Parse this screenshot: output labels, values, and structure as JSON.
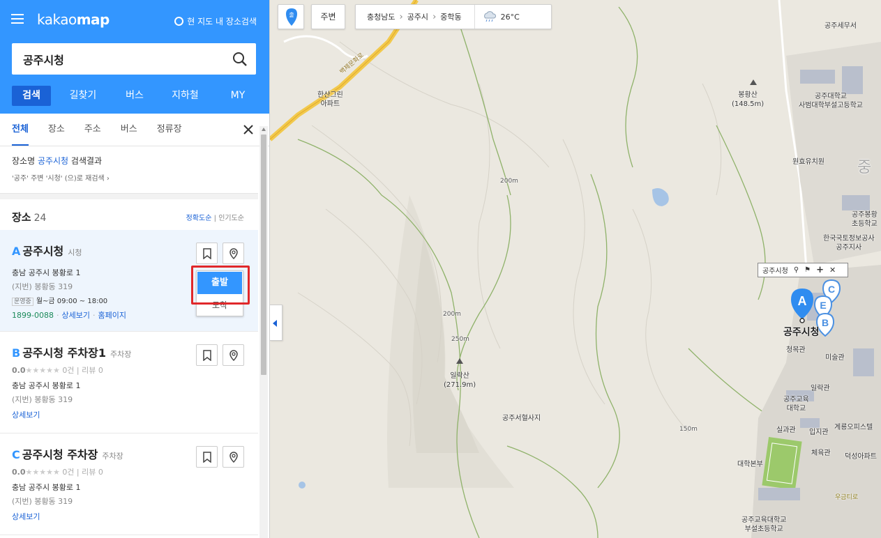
{
  "app": {
    "logo_light": "kakao",
    "logo_bold": "map",
    "area_search_label": "현 지도 내 장소검색"
  },
  "search": {
    "value": "공주시청"
  },
  "main_tabs": [
    "검색",
    "길찾기",
    "버스",
    "지하철",
    "MY"
  ],
  "sub_tabs": [
    "전체",
    "장소",
    "주소",
    "버스",
    "정류장"
  ],
  "result": {
    "prefix": "장소명 ",
    "keyword": "공주시청",
    "suffix": " 검색결과",
    "research": "'공주' 주변 '시청' (으)로 재검색"
  },
  "places": {
    "label": "장소",
    "count": "24",
    "sort_accuracy": "정확도순",
    "sort_sep": "|",
    "sort_popular": "인기도순"
  },
  "cards": [
    {
      "marker": "A",
      "name": "공주시청",
      "category": "시청",
      "address": "충남 공주시 봉황로 1",
      "jibun": "(지번) 봉황동 319",
      "hours_badge": "운영중",
      "hours": "월~금 09:00 ~ 18:00",
      "phone": "1899-0088",
      "detail": "상세보기",
      "homepage": "홈페이지"
    },
    {
      "marker": "B",
      "name": "공주시청 주차장1",
      "category": "주차장",
      "score": "0.0",
      "stars": "★★★★★",
      "reviews_count": "0건",
      "reviews": "리뷰 0",
      "address": "충남 공주시 봉황로 1",
      "jibun": "(지번) 봉황동 319",
      "detail": "상세보기"
    },
    {
      "marker": "C",
      "name": "공주시청 주차장",
      "category": "주차장",
      "score": "0.0",
      "stars": "★★★★★",
      "reviews_count": "0건",
      "reviews": "리뷰 0",
      "address": "충남 공주시 봉황로 1",
      "jibun": "(지번) 봉황동 319",
      "detail": "상세보기"
    }
  ],
  "popup": {
    "start": "출발",
    "arrive": "도착"
  },
  "map": {
    "marker_button": "출",
    "nearby": "주변",
    "breadcrumb": [
      "충청남도",
      "공주시",
      "중학동"
    ],
    "weather": "26°C",
    "tip_label": "공주시청",
    "labels": {
      "hansan": "한산그린\n아파트",
      "road": "백제문화로",
      "bonghwang": "봉황산\n(148.5m)",
      "tax": "공주세무서",
      "univ_school": "공주대학교\n사범대학부설고등학교",
      "wonhyo": "원효유치원",
      "jung": "중",
      "bonghwang_school": "공주봉황\n초등학교",
      "kdata": "한국국토정보공사\n공주지사",
      "m200a": "200m",
      "m200b": "200m",
      "m250": "250m",
      "ilrak": "일락산\n(271.9m)",
      "seohyeol": "공주서혈사지",
      "m150": "150m",
      "cityhall": "공주시청",
      "cheongmok": "청목관",
      "misul": "미술관",
      "ilrakgwan": "일락관",
      "edu_univ": "공주교육\n대학교",
      "silgwa": "실과관",
      "ipji": "입지관",
      "gyeryong": "계룡오피스텔",
      "cheyuk": "체육관",
      "deokseong": "덕성아파트",
      "bonbu": "대학본부",
      "elem": "공주교육대학교\n부설초등학교",
      "ugeum": "우금티로"
    }
  }
}
